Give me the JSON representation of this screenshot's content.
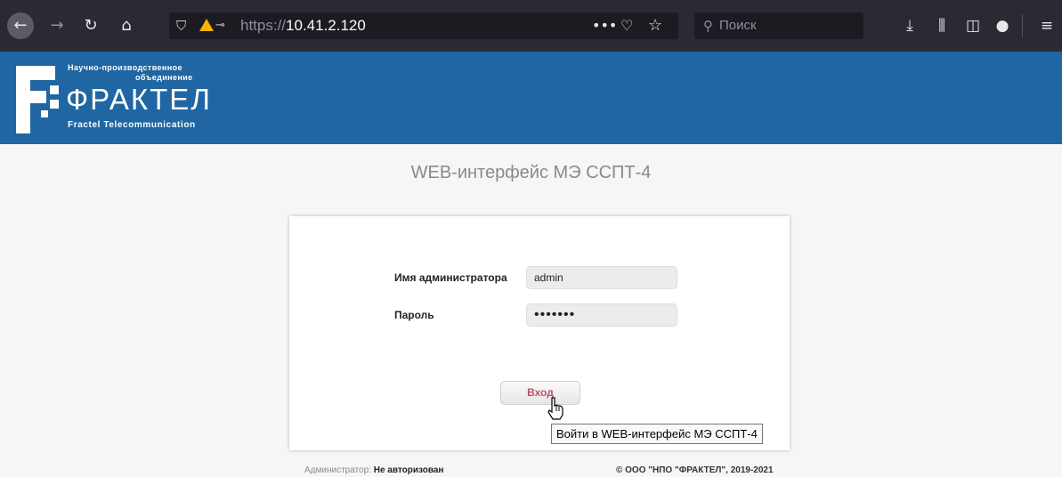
{
  "browser": {
    "url_scheme": "https://",
    "url_host": "10.41.2.120",
    "search_placeholder": "Поиск",
    "icons": [
      "back-icon",
      "forward-icon",
      "reload-icon",
      "home-icon",
      "shield-icon",
      "insecure-lock-icon",
      "key-icon",
      "page-actions-icon",
      "pocket-icon",
      "bookmark-star-icon",
      "search-icon",
      "downloads-icon",
      "library-icon",
      "sidebar-icon",
      "account-icon",
      "menu-icon"
    ]
  },
  "header": {
    "logo_line1": "Научно-производственное",
    "logo_line2": "объединение",
    "logo_name": "ФРАКТЕЛ",
    "logo_sub": "Fractel Telecommunication",
    "brand_color": "#1f66a2"
  },
  "main": {
    "title": "WEB-интерфейс МЭ ССПТ-4",
    "username_label": "Имя администратора",
    "username_value": "admin",
    "password_label": "Пароль",
    "password_value": "•••••••",
    "login_button": "Вход",
    "tooltip": "Войти в WEB-интерфейс МЭ ССПТ-4"
  },
  "footer": {
    "admin_label": "Администратор:",
    "admin_status": "Не авторизован",
    "copyright": "© ООО \"НПО \"ФРАКТЕЛ\", 2019-2021"
  }
}
